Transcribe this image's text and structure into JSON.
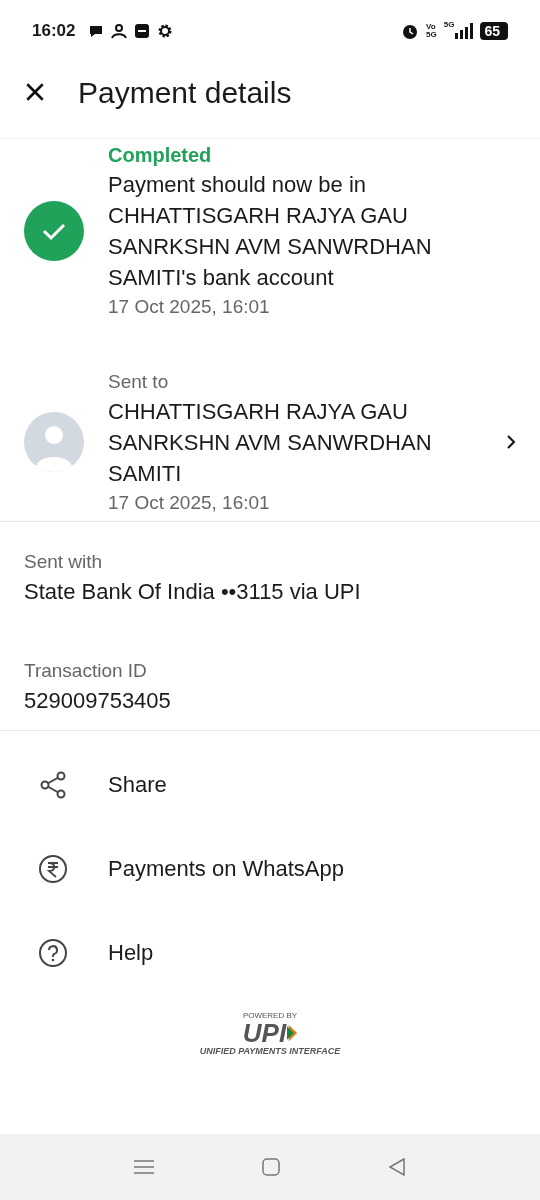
{
  "status_bar": {
    "time": "16:02",
    "volte": "Vo",
    "volte_net": "5G",
    "network": "5G",
    "battery": "65"
  },
  "header": {
    "title": "Payment details"
  },
  "status": {
    "label": "Completed",
    "completed": true,
    "message": "Payment should now be in CHHATTISGARH RAJYA GAU SANRKSHN AVM SANWRDHAN SAMITI's bank account",
    "time": "17 Oct 2025, 16:01"
  },
  "recipient": {
    "label": "Sent to",
    "name": "CHHATTISGARH RAJYA GAU SANRKSHN AVM SANWRDHAN SAMITI",
    "time": "17 Oct 2025, 16:01"
  },
  "details": [
    {
      "label": "Sent with",
      "value": "State Bank Of India ••3115 via UPI"
    },
    {
      "label": "Transaction ID",
      "value": "529009753405"
    }
  ],
  "actions": [
    {
      "kind": "share",
      "label": "Share"
    },
    {
      "kind": "rupee",
      "label": "Payments on WhatsApp"
    },
    {
      "kind": "help",
      "label": "Help"
    }
  ],
  "footer": {
    "powered": "POWERED BY",
    "logo": "UPI",
    "tagline": "UNIFIED PAYMENTS INTERFACE"
  }
}
